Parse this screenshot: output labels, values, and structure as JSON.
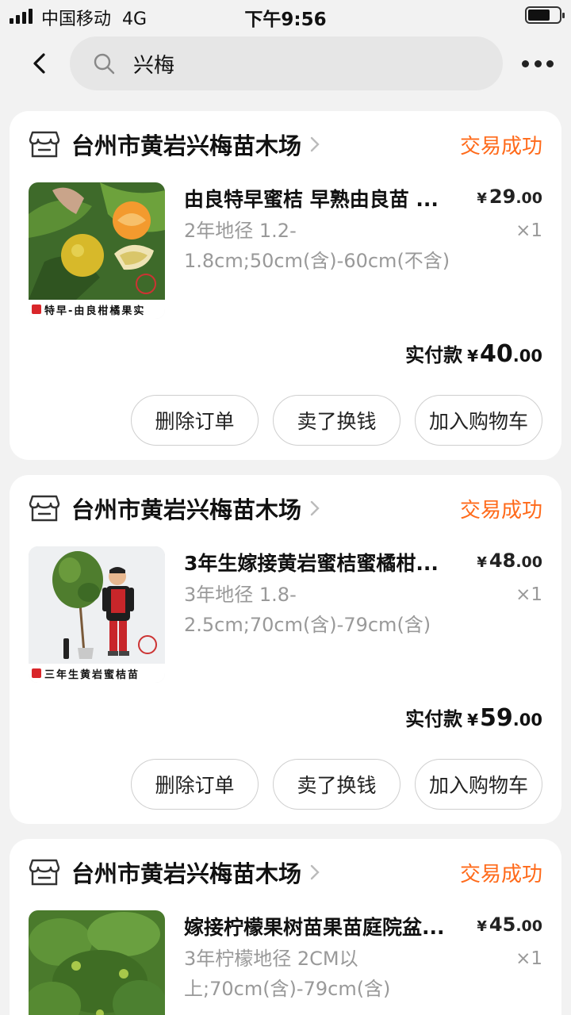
{
  "status_bar": {
    "carrier": "中国移动",
    "network": "4G",
    "time": "下午9:56"
  },
  "nav": {
    "search_value": "兴梅"
  },
  "orders": [
    {
      "shop_name": "台州市黄岩兴梅苗木场",
      "status": "交易成功",
      "title": "由良特早蜜桔 早熟由良苗 ...",
      "sku": "2年地径 1.2-1.8cm;50cm(含)-60cm(不含)",
      "price_currency": "¥",
      "price_int": "29",
      "price_dec": ".00",
      "quantity": "×1",
      "thumb_caption": "特早-由良柑橘果实",
      "paid_label": "实付款",
      "paid_currency": "¥",
      "paid_int": "40",
      "paid_dec": ".00",
      "buttons": [
        "删除订单",
        "卖了换钱",
        "加入购物车"
      ]
    },
    {
      "shop_name": "台州市黄岩兴梅苗木场",
      "status": "交易成功",
      "title": "3年生嫁接黄岩蜜桔蜜橘柑...",
      "sku": "3年地径 1.8-2.5cm;70cm(含)-79cm(含)",
      "price_currency": "¥",
      "price_int": "48",
      "price_dec": ".00",
      "quantity": "×1",
      "thumb_caption": "三年生黄岩蜜桔苗",
      "paid_label": "实付款",
      "paid_currency": "¥",
      "paid_int": "59",
      "paid_dec": ".00",
      "buttons": [
        "删除订单",
        "卖了换钱",
        "加入购物车"
      ]
    },
    {
      "shop_name": "台州市黄岩兴梅苗木场",
      "status": "交易成功",
      "title": "嫁接柠檬果树苗果苗庭院盆...",
      "sku": "3年柠檬地径 2CM以上;70cm(含)-79cm(含)",
      "price_currency": "¥",
      "price_int": "45",
      "price_dec": ".00",
      "quantity": "×1"
    }
  ],
  "colors": {
    "accent_status": "#ff6a1a",
    "background": "#f2f2f2"
  }
}
